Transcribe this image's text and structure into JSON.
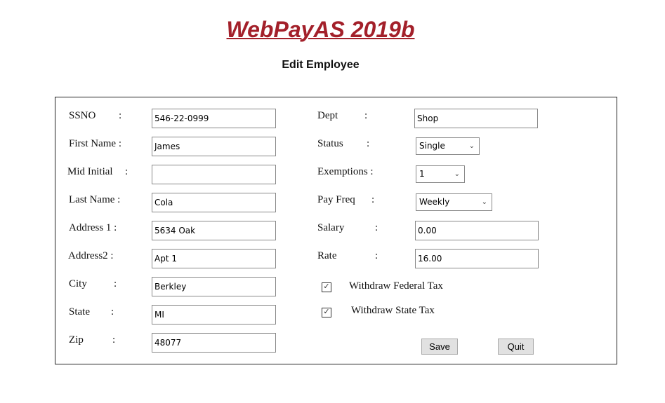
{
  "header": {
    "title": "WebPayAS 2019b",
    "subtitle": "Edit Employee"
  },
  "left": [
    {
      "label": "SSNO",
      "value": "546-22-0999"
    },
    {
      "label": "First Name",
      "value": "James"
    },
    {
      "label": "Mid Initial",
      "value": ""
    },
    {
      "label": "Last Name",
      "value": "Cola"
    },
    {
      "label": "Address 1",
      "value": "5634 Oak"
    },
    {
      "label": "Address2",
      "value": "Apt 1"
    },
    {
      "label": "City",
      "value": "Berkley"
    },
    {
      "label": "State",
      "value": "MI"
    },
    {
      "label": "Zip",
      "value": "48077"
    }
  ],
  "right": {
    "dept": {
      "label": "Dept",
      "value": "Shop"
    },
    "status": {
      "label": "Status",
      "value": "Single"
    },
    "exemptions": {
      "label": "Exemptions",
      "value": "1"
    },
    "payfreq": {
      "label": "Pay Freq",
      "value": "Weekly"
    },
    "salary": {
      "label": "Salary",
      "value": "0.00"
    },
    "rate": {
      "label": "Rate",
      "value": "16.00"
    }
  },
  "checks": {
    "federal": {
      "label": "Withdraw Federal Tax",
      "checked": true
    },
    "state": {
      "label": "Withdraw State Tax",
      "checked": true
    }
  },
  "buttons": {
    "save": "Save",
    "quit": "Quit"
  },
  "colon": ":"
}
